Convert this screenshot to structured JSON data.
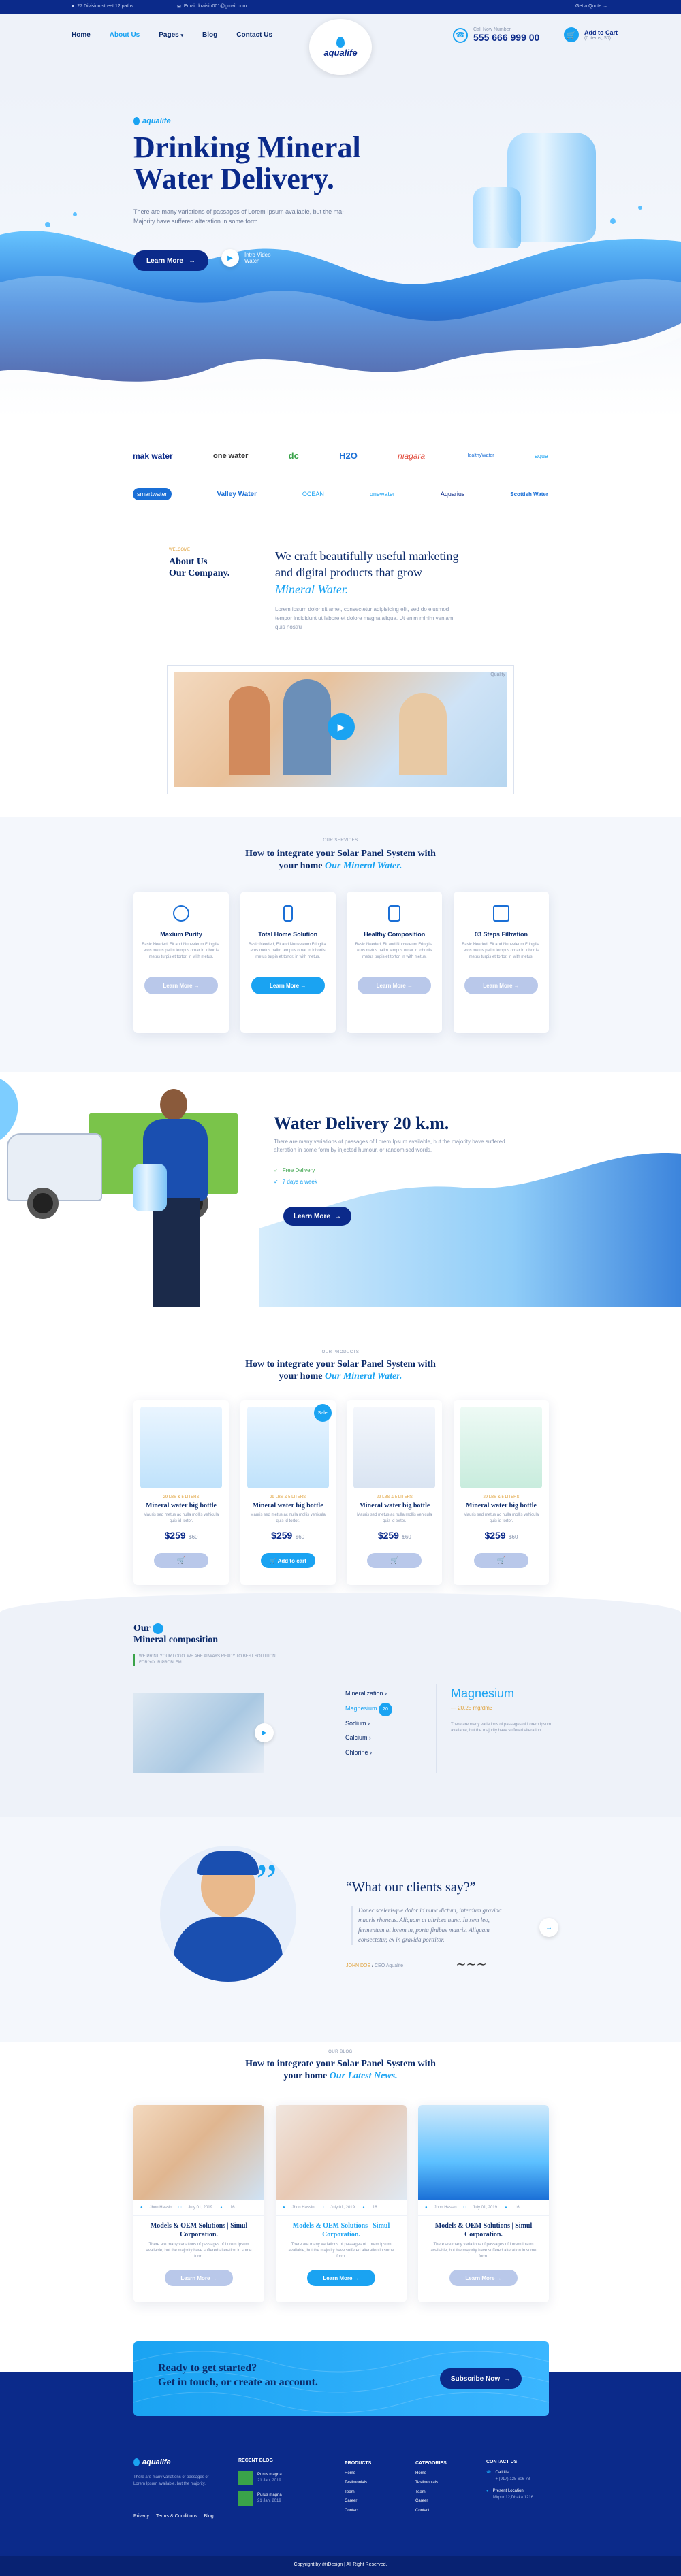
{
  "topbar": {
    "address": "27 Division street 12 paths",
    "email": "Email: kraisin001@gmail.com",
    "login": "Get a Quote →"
  },
  "nav": {
    "items": [
      "Home",
      "About Us",
      "Pages",
      "Blog",
      "Contact Us"
    ],
    "logo": "aqualife",
    "phone_label": "Call Now Number",
    "phone": "555 666 999 00",
    "cart_label": "Add to Cart",
    "cart_sub": "(0 items, $0)"
  },
  "hero": {
    "brand": "aqualife",
    "title_line1": "Drinking Mineral",
    "title_line2": "Water Delivery.",
    "text": "There are many variations of passages of Lorem Ipsum available, but the ma- Majority have suffered alteration in some form.",
    "learn_more": "Learn More",
    "video_label": "Intro Video",
    "video_sub": "Watch"
  },
  "brands": [
    "mak water",
    "one water",
    "dc",
    "H2O",
    "niagara",
    "HealthyWater",
    "aqua",
    "smartwater",
    "Valley Water",
    "OCEAN",
    "onewater",
    "Aquarius",
    "Scottish Water"
  ],
  "about": {
    "eyebrow": "WELCOME",
    "title_line1": "About Us",
    "title_line2": "Our Company.",
    "heading_line1": "We craft beautifully useful marketing",
    "heading_line2": "and digital products that grow",
    "heading_accent": "Mineral Water.",
    "text": "Lorem ipsum dolor sit amet, consectetur adipisicing elit, sed do eiusmod tempor incididunt ut labore et dolore magna aliqua. Ut enim minim veniam, quis nostru",
    "video_tag": "Quality"
  },
  "services": {
    "eyebrow": "OUR SERVICES",
    "title": "How to integrate your Solar Panel System with",
    "title_line2": "your home",
    "title_accent": "Our Mineral Water.",
    "items": [
      {
        "title": "Maxium Purity",
        "text": "Basic Needed, Fit and Nunveleum Fringilla. eros metus palim tempus ornar in lobortis metus turpis et tortor, in with metus.",
        "button": "Learn More"
      },
      {
        "title": "Total Home Solution",
        "text": "Basic Needed, Fit and Nunveleum Fringilla. eros metus palim tempus ornar in lobortis metus turpis et tortor, in with metus.",
        "button": "Learn More"
      },
      {
        "title": "Healthy Composition",
        "text": "Basic Needed, Fit and Nunveleum Fringilla. eros metus palim tempus ornar in lobortis metus turpis et tortor, in with metus.",
        "button": "Learn More"
      },
      {
        "title": "03 Steps Filtration",
        "text": "Basic Needed, Fit and Nunveleum Fringilla. eros metus palim tempus ornar in lobortis metus turpis et tortor, in with metus.",
        "button": "Learn More"
      }
    ]
  },
  "delivery": {
    "title": "Water Delivery 20 k.m.",
    "text": "There are many variations of passages of Lorem Ipsum available, but the majority have suffered alteration in some form by injected humour, or randomised words.",
    "check1": "Free Delivery",
    "check2": "7 days a week",
    "button": "Learn More"
  },
  "products": {
    "eyebrow": "OUR PRODUCTS",
    "title": "How to integrate your Solar Panel System with",
    "title_line2": "your home",
    "title_accent": "Our Mineral Water.",
    "items": [
      {
        "tag": "29 LBS & 5 LITERS",
        "name": "Mineral water big bottle",
        "text": "Mauris sed metus ac nulla mollis vehicula quis id tortor.",
        "price": "$259",
        "old": "$60",
        "badge": "",
        "button": ""
      },
      {
        "tag": "29 LBS & 5 LITERS",
        "name": "Mineral water big bottle",
        "text": "Mauris sed metus ac nulla mollis vehicula quis id tortor.",
        "price": "$259",
        "old": "$60",
        "badge": "Sale",
        "button": "Add to cart"
      },
      {
        "tag": "29 LBS & 5 LITERS",
        "name": "Mineral water big bottle",
        "text": "Mauris sed metus ac nulla mollis vehicula quis id tortor.",
        "price": "$259",
        "old": "$60",
        "badge": "",
        "button": ""
      },
      {
        "tag": "29 LBS & 5 LITERS",
        "name": "Mineral water big bottle",
        "text": "Mauris sed metus ac nulla mollis vehicula quis id tortor.",
        "price": "$259",
        "old": "$60",
        "badge": "",
        "button": ""
      }
    ]
  },
  "composition": {
    "title_line1": "Our",
    "title_line2": "Mineral composition",
    "sub": "WE PRINT YOUR LOGO. WE ARE ALWAYS READY TO BEST SOLUTION FOR YOUR PROBLEM.",
    "list": [
      "Mineralization",
      "Magnesium",
      "Sodium",
      "Calcium",
      "Chlorine"
    ],
    "active_badge": "20",
    "detail_title": "Magnesium",
    "detail_value": "— 20.25 mg/dm3",
    "detail_text": "There are many variations of passages of Lorem Ipsum available, but the majority have suffered alteration."
  },
  "testimonial": {
    "title": "“What our clients say?”",
    "quote": "Donec scelerisque dolor id nunc dictum, interdum gravida mauris rhoncus. Aliquam at ultrices nunc. In sem leo, fermentum at lorem in, porta finibus mauris. Aliquam consectetur, ex in gravida porttitor.",
    "author": "JOHN DOE",
    "role": "CEO Aqualife"
  },
  "blog": {
    "eyebrow": "OUR BLOG",
    "title": "How to integrate your Solar Panel System with",
    "title_line2": "your home",
    "title_accent": "Our Latest News.",
    "items": [
      {
        "author": "Jhon Hassin",
        "date": "July 01, 2019",
        "comments": "16",
        "title": "Models & OEM Solutions | Simul Corporation.",
        "text": "There are many variations of passages of Lorem Ipsum available, but the majority have suffered alteration in some form.",
        "button": "Learn More"
      },
      {
        "author": "Jhon Hassin",
        "date": "July 01, 2019",
        "comments": "16",
        "title": "Models & OEM Solutions | Simul Corporation.",
        "text": "There are many variations of passages of Lorem Ipsum available, but the majority have suffered alteration in some form.",
        "button": "Learn More"
      },
      {
        "author": "Jhon Hassin",
        "date": "July 01, 2019",
        "comments": "16",
        "title": "Models & OEM Solutions | Simul Corporation.",
        "text": "There are many variations of passages of Lorem Ipsum available, but the majority have suffered alteration in some form.",
        "button": "Learn More"
      }
    ]
  },
  "cta": {
    "line1": "Ready to get started?",
    "line2": "Get in touch, or create an account.",
    "button": "Subscribe Now"
  },
  "footer": {
    "logo": "aqualife",
    "about": "There are many variations of passages of Lorem Ipsum available, but the majority.",
    "links": [
      "Privacy",
      "Terms & Conditions",
      "Blog"
    ],
    "recent_title": "RECENT BLOG",
    "recent": [
      {
        "title": "Purus magna",
        "date": "21 Jan, 2019"
      },
      {
        "title": "Purus magna",
        "date": "21 Jan, 2019"
      }
    ],
    "products_title": "PRODUCTS",
    "products": [
      "Home",
      "Testimonials",
      "Team",
      "Career",
      "Contact"
    ],
    "categories_title": "CATEGORIES",
    "categories": [
      "Home",
      "Testimonials",
      "Team",
      "Career",
      "Contact"
    ],
    "contact_title": "CONTACT US",
    "contact_call": "Call Us",
    "contact_phone": "+ (917) 125 606 78",
    "contact_loc": "Present Location",
    "contact_addr": "Mirpur 12,Dhaka 1216",
    "copyright": "Copyright by @iDesign | All Right Reserved."
  },
  "colors": {
    "navy": "#0b2a8a",
    "cyan": "#1aa3f2",
    "light": "#eef2f9"
  }
}
